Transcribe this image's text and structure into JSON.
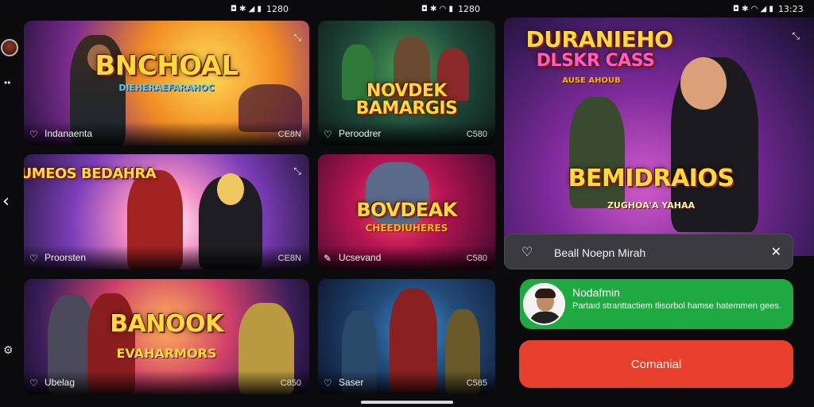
{
  "status_bars": [
    {
      "icons": "◘ ✱ ◢ ▮",
      "time": "1280"
    },
    {
      "icons": "◘ ✱ ◠ ▮",
      "time": "1280"
    },
    {
      "icons": "◘ ✱ ◠ ◢ ▮",
      "time": "13:23"
    }
  ],
  "rail": {
    "back_icon": "‹",
    "dots_icon": "••",
    "settings_icon": "⚙"
  },
  "cards": [
    {
      "title": "BNCHOAL",
      "subtitle": "DIEHERAEFARAHOC",
      "name": "Indanaenta",
      "tag": "CE8N"
    },
    {
      "title": "NOVDEK BAMARGIS",
      "subtitle": "",
      "name": "Peroodrer",
      "tag": "C580"
    },
    {
      "title": "PUMEOS BEDAHRA",
      "subtitle": "",
      "name": "Proorsten",
      "tag": "CE8N"
    },
    {
      "title": "BOVDEAK",
      "subtitle": "CHEEDIUHERES",
      "name": "Ucsevand",
      "tag": "C580"
    },
    {
      "title": "BANOOK",
      "subtitle": "EVAHARMORS",
      "name": "Ubelag",
      "tag": "C850"
    },
    {
      "title": "",
      "subtitle": "",
      "name": "Saser",
      "tag": "C585"
    }
  ],
  "hero": {
    "title_top": "DURANIEHO",
    "title_mid": "DLSKR CASS",
    "caption": "AUSE AHOUB",
    "title_main": "BEMIDRAIOS",
    "subtitle_main": "ZUGHOA'A YAHAA"
  },
  "panel": {
    "label": "Beall Noepn Mirah"
  },
  "profile": {
    "name": "Nodafmin",
    "desc": "Partaid stranttactiem tlisorbol hamse hatemmen gees."
  },
  "cta": {
    "label": "Comanial"
  },
  "colors": {
    "accent_green": "#1faa41",
    "accent_red": "#e8402c",
    "panel_gray": "#3b3b3f"
  }
}
